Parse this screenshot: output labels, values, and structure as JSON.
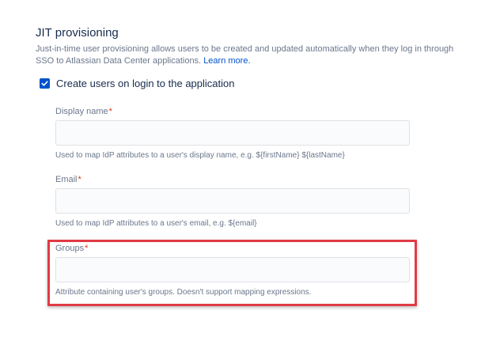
{
  "section": {
    "title": "JIT provisioning",
    "description": "Just-in-time user provisioning allows users to be created and updated automatically when they log in through SSO to Atlassian Data Center applications.",
    "learn_more": "Learn more."
  },
  "checkbox": {
    "label": "Create users on login to the application",
    "checked": true
  },
  "fields": {
    "display_name": {
      "label": "Display name",
      "required_mark": "*",
      "value": "",
      "helper": "Used to map IdP attributes to a user's display name, e.g. ${firstName} ${lastName}"
    },
    "email": {
      "label": "Email",
      "required_mark": "*",
      "value": "",
      "helper": "Used to map IdP attributes to a user's email, e.g. ${email}"
    },
    "groups": {
      "label": "Groups",
      "required_mark": "*",
      "value": "",
      "helper": "Attribute containing user's groups. Doesn't support mapping expressions."
    }
  },
  "colors": {
    "accent": "#0052cc",
    "highlight": "#e03b44",
    "required": "#de350b"
  }
}
